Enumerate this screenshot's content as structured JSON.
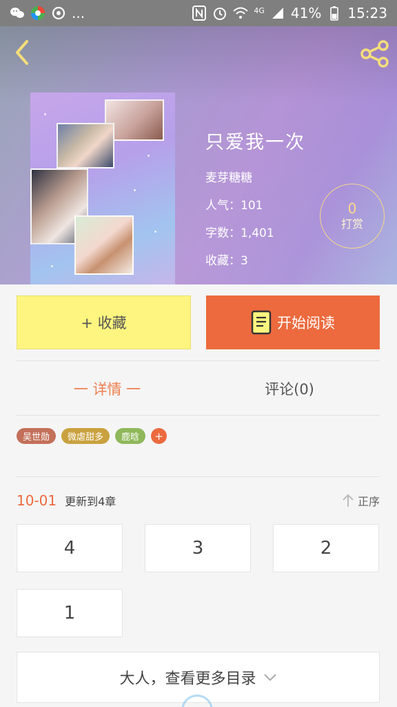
{
  "status_bar": {
    "more": "...",
    "signal_type": "4G",
    "battery": "41%",
    "time": "15:23"
  },
  "book": {
    "title": "只爱我一次",
    "author": "麦芽糖糖",
    "popularity": "人气：101",
    "word_count": "字数：1,401",
    "favorites": "收藏：3"
  },
  "tip": {
    "count": "0",
    "label": "打赏"
  },
  "actions": {
    "favorite_label": "+ 收藏",
    "read_label": "开始阅读"
  },
  "tabs": {
    "detail": "一 详情 一",
    "comments": "评论(0)"
  },
  "tags": [
    {
      "label": "吴世勋",
      "color": "#c3705a"
    },
    {
      "label": "微虐甜多",
      "color": "#c9a13e"
    },
    {
      "label": "鹿晗",
      "color": "#8fb85a"
    }
  ],
  "tag_more": "+",
  "update": {
    "date": "10-01",
    "text": "更新到4章",
    "sort_label": "正序"
  },
  "chapters": [
    "4",
    "3",
    "2",
    "1"
  ],
  "more_toc": "大人，查看更多目录",
  "icons": {
    "back": "chevron-left-icon",
    "share": "share-icon",
    "read": "book-icon",
    "sort": "arrow-up-icon",
    "expand": "chevron-down-icon"
  },
  "colors": {
    "accent_orange": "#ec6a3e",
    "favorite_yellow": "#fdf57f",
    "tip_gold": "#f5d78a"
  }
}
